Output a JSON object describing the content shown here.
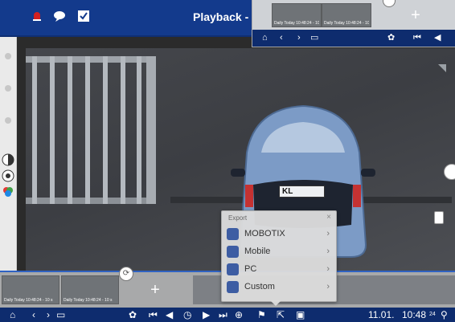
{
  "header": {
    "title": "Playback - G"
  },
  "mini_panel": {
    "thumbnails": [
      {
        "caption": "Daily Today 10:48:24 - 10 s"
      },
      {
        "caption": "Daily Today 10:48:24 - 10 s"
      }
    ],
    "add_label": "+"
  },
  "filmstrip": {
    "thumbnails": [
      {
        "caption": "Daily Today 10:48:24 - 10 s"
      },
      {
        "caption": "Daily Today 10:48:24 - 10 s"
      }
    ],
    "add_label": "+"
  },
  "plate": {
    "text": "KL"
  },
  "export_popup": {
    "title": "Export",
    "close": "×",
    "items": [
      {
        "label": "MOBOTIX",
        "chevron": "›"
      },
      {
        "label": "Mobile",
        "chevron": "›"
      },
      {
        "label": "PC",
        "chevron": "›"
      },
      {
        "label": "Custom",
        "chevron": "›"
      }
    ]
  },
  "toolbar": {
    "date": "11.01.",
    "time": "10:48",
    "time_small": "24"
  },
  "colors": {
    "brand_blue": "#133a8c",
    "toolbar_blue": "#0e2c6e",
    "accent_blue": "#2f62c2"
  }
}
